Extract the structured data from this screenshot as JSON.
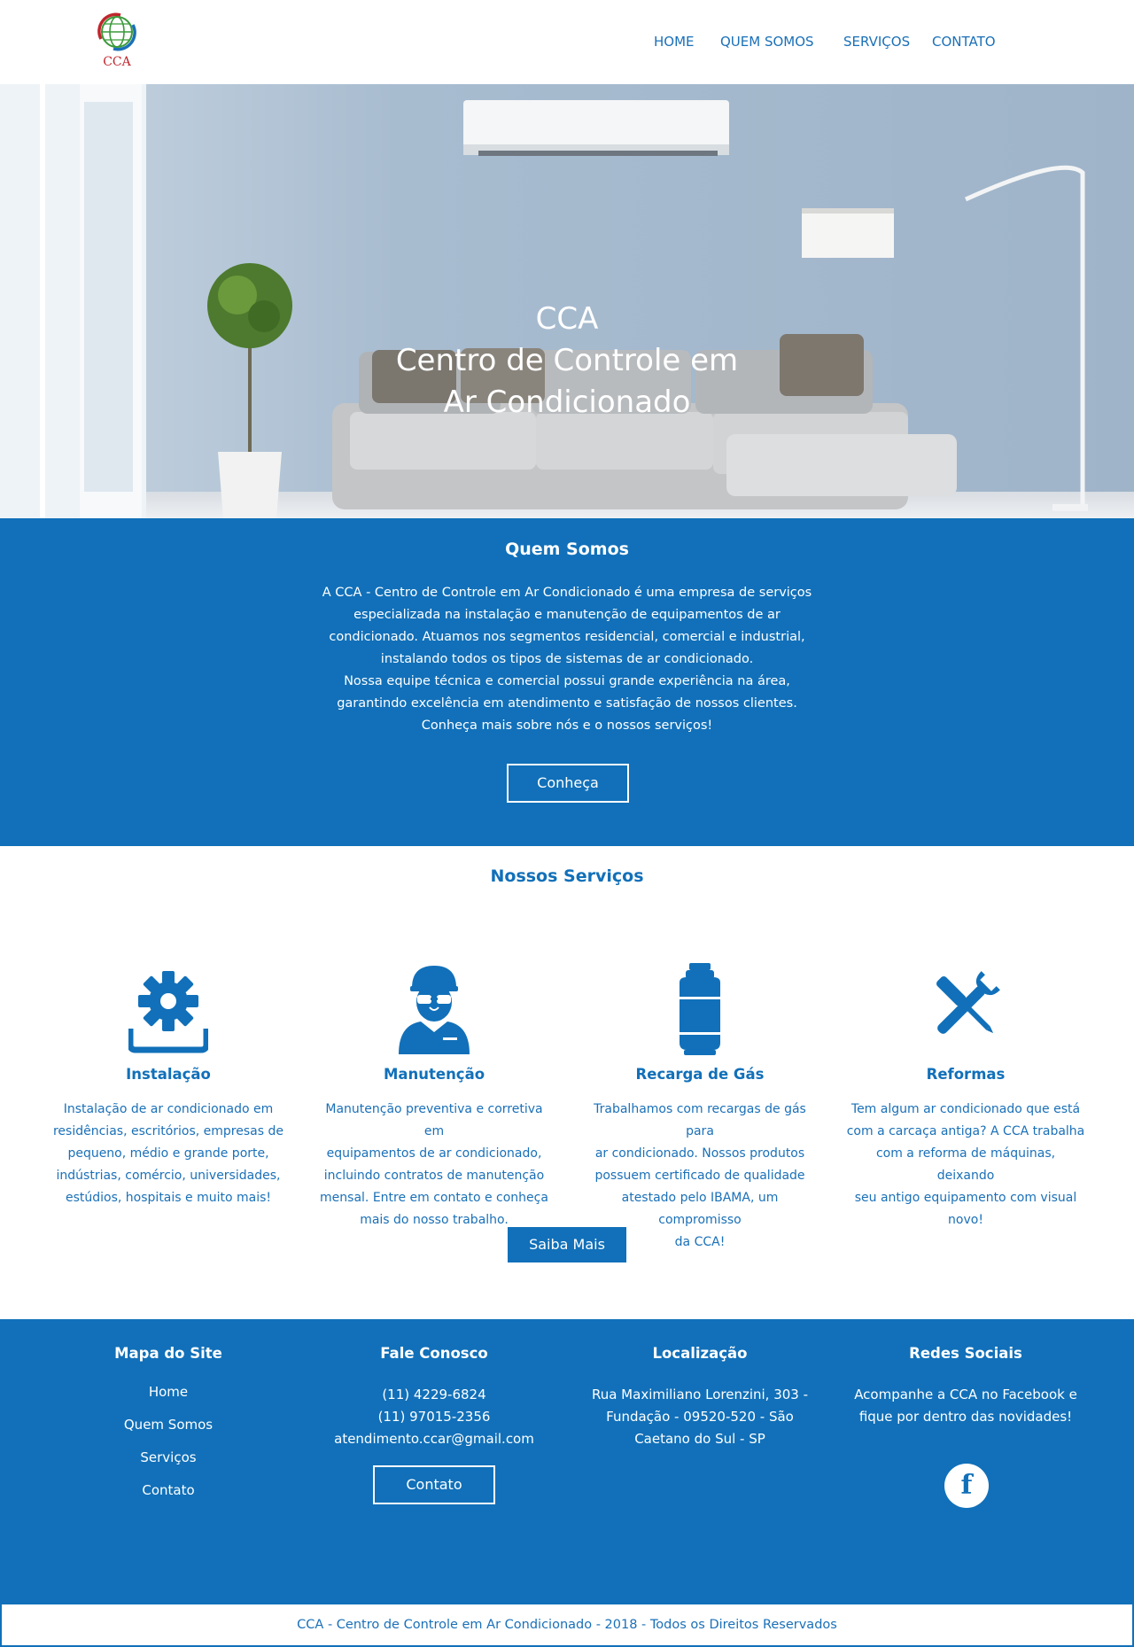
{
  "header": {
    "logo_text": "CCA",
    "nav": [
      "HOME",
      "QUEM SOMOS",
      "SERVIÇOS",
      "CONTATO"
    ]
  },
  "hero": {
    "title_lines": [
      "CCA",
      "Centro de Controle em",
      "Ar Condicionado"
    ]
  },
  "about": {
    "title": "Quem Somos",
    "lines": [
      "A CCA - Centro de Controle em Ar Condicionado é uma empresa de serviços",
      "especializada na instalação e manutenção de equipamentos de ar",
      "condicionado. Atuamos nos segmentos residencial, comercial e industrial,",
      "instalando todos os tipos de sistemas de ar condicionado.",
      "Nossa equipe técnica e comercial possui grande experiência na área,",
      "garantindo excelência em atendimento e satisfação de nossos clientes.",
      "Conheça mais sobre nós e o nossos serviços!"
    ],
    "button": "Conheça"
  },
  "services": {
    "title": "Nossos Serviços",
    "items": [
      {
        "icon": "gear-install-icon",
        "title": "Instalação",
        "lines": [
          "Instalação de ar condicionado em",
          "residências, escritórios, empresas de",
          "pequeno, médio e grande porte,",
          "indústrias, comércio, universidades,",
          "estúdios, hospitais e muito mais!"
        ]
      },
      {
        "icon": "technician-icon",
        "title": "Manutenção",
        "lines": [
          "Manutenção preventiva e corretiva em",
          "equipamentos de ar condicionado,",
          "incluindo contratos de manutenção",
          "mensal. Entre em contato e conheça",
          "mais do nosso trabalho."
        ]
      },
      {
        "icon": "gas-cylinder-icon",
        "title": "Recarga de Gás",
        "lines": [
          "Trabalhamos com recargas de gás para",
          "ar condicionado. Nossos produtos",
          "possuem certificado de qualidade",
          "atestado pelo IBAMA, um compromisso",
          "da CCA!"
        ]
      },
      {
        "icon": "tools-icon",
        "title": "Reformas",
        "lines": [
          "Tem algum ar condicionado que está",
          "com a carcaça antiga? A CCA trabalha",
          "com a reforma de máquinas, deixando",
          "seu antigo equipamento com visual",
          "novo!"
        ]
      }
    ],
    "button": "Saiba Mais"
  },
  "footer": {
    "sitemap": {
      "title": "Mapa do Site",
      "links": [
        "Home",
        "Quem Somos",
        "Serviços",
        "Contato"
      ]
    },
    "contact": {
      "title": "Fale Conosco",
      "lines": [
        "(11) 4229-6824",
        "(11) 97015-2356",
        "atendimento.ccar@gmail.com"
      ],
      "button": "Contato"
    },
    "location": {
      "title": "Localização",
      "lines": [
        "Rua Maximiliano Lorenzini, 303 -",
        "Fundação - 09520-520 - São",
        "Caetano do Sul - SP"
      ]
    },
    "social": {
      "title": "Redes Sociais",
      "lines": [
        "Acompanhe a CCA no Facebook e",
        "fique por dentro das novidades!"
      ],
      "facebook_glyph": "f"
    },
    "copyright": "CCA - Centro de Controle em Ar Condicionado - 2018 - Todos os Direitos Reservados"
  },
  "colors": {
    "primary": "#1170b9",
    "logo_red": "#c0262d",
    "logo_green": "#3a9a3a"
  }
}
